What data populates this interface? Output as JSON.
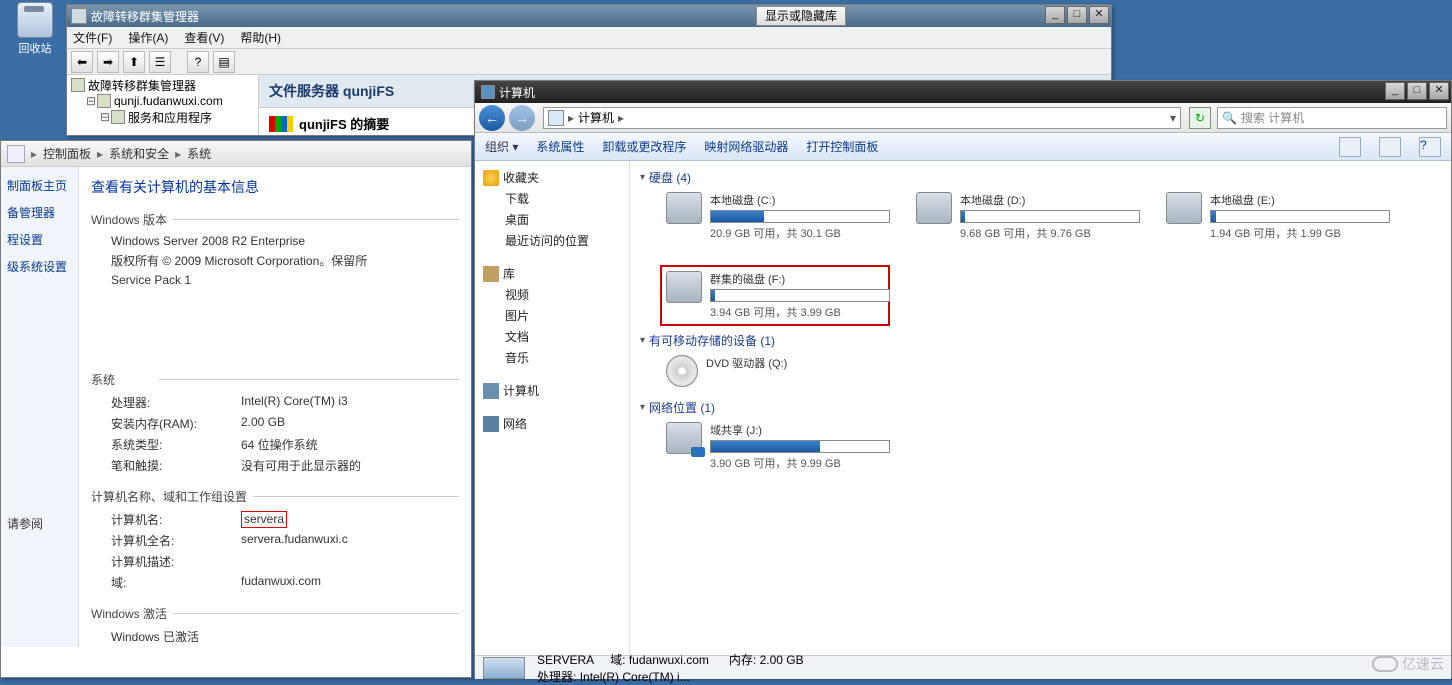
{
  "desktop": {
    "recycle": "回收站"
  },
  "top_button": "显示或隐藏库",
  "mmc": {
    "title": "故障转移群集管理器",
    "menu": {
      "file": "文件(F)",
      "action": "操作(A)",
      "view": "查看(V)",
      "help": "帮助(H)"
    },
    "tree": {
      "root": "故障转移群集管理器",
      "cluster": "qunji.fudanwuxi.com",
      "services": "服务和应用程序"
    },
    "detail": {
      "header": "文件服务器 qunjiFS",
      "summary": "qunjiFS 的摘要"
    }
  },
  "cp": {
    "crumbs": [
      "控制面板",
      "系统和安全",
      "系统"
    ],
    "sidebar": {
      "home": "制面板主页",
      "devmgr": "备管理器",
      "remote": "程设置",
      "advanced": "级系统设置",
      "seealso": "请参阅"
    },
    "heading": "查看有关计算机的基本信息",
    "sections": {
      "win": "Windows 版本",
      "sys": "系统",
      "name": "计算机名称、域和工作组设置",
      "act": "Windows 激活"
    },
    "win": {
      "edition": "Windows Server 2008 R2 Enterprise",
      "copyright": "版权所有 © 2009 Microsoft Corporation。保留所",
      "sp": "Service Pack 1"
    },
    "sys": {
      "cpu_k": "处理器:",
      "cpu_v": "Intel(R) Core(TM) i3",
      "ram_k": "安装内存(RAM):",
      "ram_v": "2.00 GB",
      "type_k": "系统类型:",
      "type_v": "64 位操作系统",
      "pen_k": "笔和触摸:",
      "pen_v": "没有可用于此显示器的"
    },
    "name": {
      "cn_k": "计算机名:",
      "cn_v": "servera",
      "fn_k": "计算机全名:",
      "fn_v": "servera.fudanwuxi.c",
      "desc_k": "计算机描述:",
      "dom_k": "域:",
      "dom_v": "fudanwuxi.com"
    },
    "act": {
      "line": "Windows 已激活"
    }
  },
  "explorer": {
    "title": "计算机",
    "addr_dd": "▸",
    "search_placeholder": "搜索 计算机",
    "cmdbar": {
      "org": "组织 ▾",
      "props": "系统属性",
      "uninstall": "卸载或更改程序",
      "mapnet": "映射网络驱动器",
      "opencp": "打开控制面板"
    },
    "navpane": {
      "favorites": "收藏夹",
      "downloads": "下载",
      "desktop": "桌面",
      "recent": "最近访问的位置",
      "libraries": "库",
      "videos": "视频",
      "pictures": "图片",
      "documents": "文档",
      "music": "音乐",
      "computer": "计算机",
      "network": "网络"
    },
    "cats": {
      "hdd": "硬盘 (4)",
      "removable": "有可移动存储的设备 (1)",
      "netloc": "网络位置 (1)"
    },
    "drives": {
      "c": {
        "name": "本地磁盘 (C:)",
        "txt": "20.9 GB 可用，共 30.1 GB",
        "fill": 30
      },
      "d": {
        "name": "本地磁盘 (D:)",
        "txt": "9.68 GB 可用，共 9.76 GB",
        "fill": 2
      },
      "e": {
        "name": "本地磁盘 (E:)",
        "txt": "1.94 GB 可用，共 1.99 GB",
        "fill": 3
      },
      "f": {
        "name": "群集的磁盘 (F:)",
        "txt": "3.94 GB 可用，共 3.99 GB",
        "fill": 2
      },
      "dvd": {
        "name": "DVD 驱动器 (Q:)"
      },
      "j": {
        "name": "域共享 (J:)",
        "txt": "3.90 GB 可用，共 9.99 GB",
        "fill": 61
      }
    },
    "status": {
      "name": "SERVERA",
      "dom_k": "域:",
      "dom_v": "fudanwuxi.com",
      "mem_k": "内存:",
      "mem_v": "2.00 GB",
      "cpu_k": "处理器:",
      "cpu_v": "Intel(R) Core(TM) i..."
    }
  },
  "watermark": "亿速云"
}
